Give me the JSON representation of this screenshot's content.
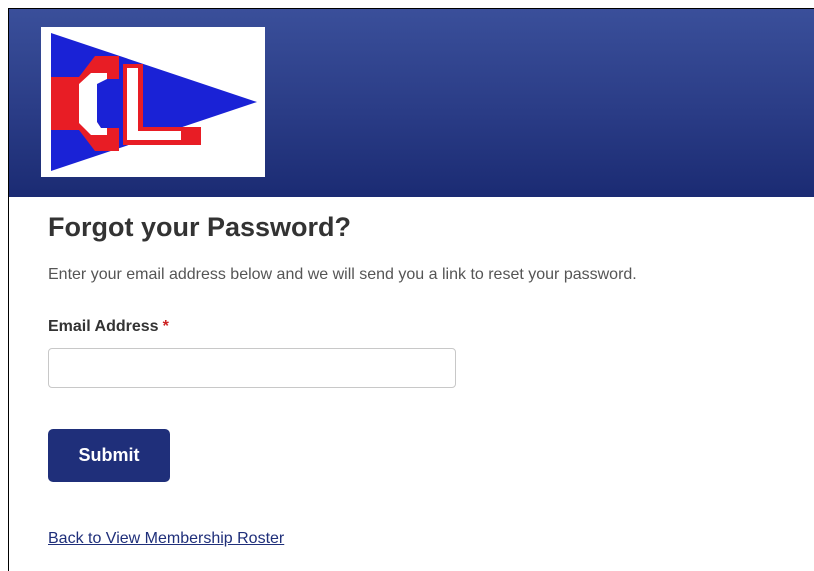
{
  "header": {
    "logo_text": "CL",
    "colors": {
      "banner": "#2a3c86",
      "pennant_red": "#e81d25",
      "pennant_blue": "#1a22d6"
    }
  },
  "form": {
    "title": "Forgot your Password?",
    "instructions": "Enter your email address below and we will send you a link to reset your password.",
    "email_label": "Email Address",
    "required_marker": "*",
    "email_value": "",
    "email_placeholder": "",
    "submit_label": "Submit"
  },
  "footer": {
    "back_link": "Back to View Membership Roster"
  },
  "colors": {
    "button": "#1f2f7a",
    "required": "#cc2222",
    "link": "#1f2f7a"
  }
}
